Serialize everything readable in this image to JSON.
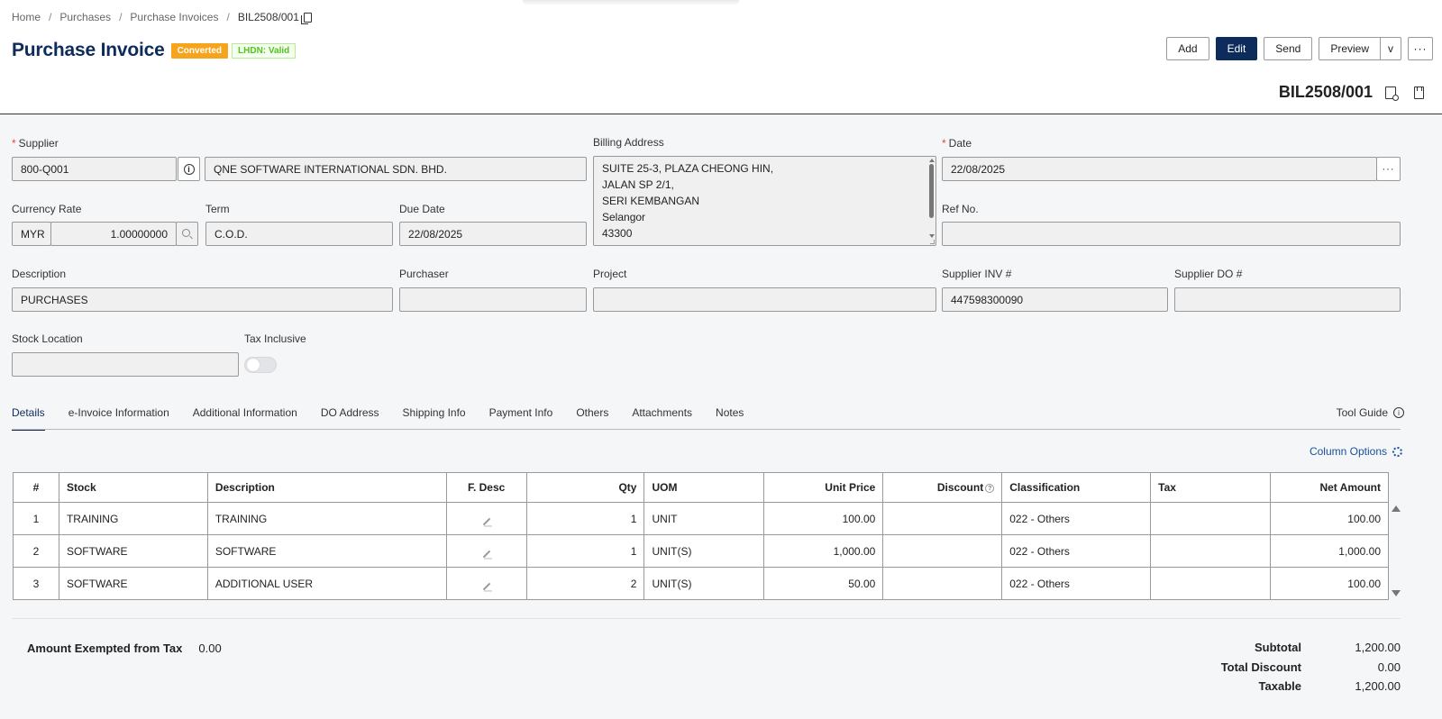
{
  "breadcrumb": [
    "Home",
    "Purchases",
    "Purchase Invoices",
    "BIL2508/001"
  ],
  "page_title": "Purchase Invoice",
  "badges": {
    "status": "Converted",
    "lhdn": "LHDN: Valid"
  },
  "actions": {
    "add": "Add",
    "edit": "Edit",
    "send": "Send",
    "preview": "Preview",
    "caret": "v",
    "more": "···"
  },
  "doc_number": "BIL2508/001",
  "form": {
    "supplier_label": "Supplier",
    "supplier_code": "800-Q001",
    "supplier_name": "QNE SOFTWARE INTERNATIONAL SDN. BHD.",
    "billing_label": "Billing Address",
    "billing_lines": [
      "SUITE 25-3, PLAZA CHEONG HIN,",
      "JALAN SP 2/1,",
      "SERI KEMBANGAN",
      "Selangor",
      "43300"
    ],
    "date_label": "Date",
    "date_value": "22/08/2025",
    "currency_label": "Currency Rate",
    "currency_code": "MYR",
    "currency_rate": "1.00000000",
    "term_label": "Term",
    "term_value": "C.O.D.",
    "due_label": "Due Date",
    "due_value": "22/08/2025",
    "ref_label": "Ref No.",
    "ref_value": "",
    "description_label": "Description",
    "description_value": "PURCHASES",
    "purchaser_label": "Purchaser",
    "purchaser_value": "",
    "project_label": "Project",
    "project_value": "",
    "supplier_inv_label": "Supplier INV #",
    "supplier_inv_value": "447598300090",
    "supplier_do_label": "Supplier DO #",
    "supplier_do_value": "",
    "stock_location_label": "Stock Location",
    "stock_location_value": "",
    "tax_inclusive_label": "Tax Inclusive",
    "tax_inclusive_on": false
  },
  "tabs": [
    "Details",
    "e-Invoice Information",
    "Additional Information",
    "DO Address",
    "Shipping Info",
    "Payment Info",
    "Others",
    "Attachments",
    "Notes"
  ],
  "tool_guide": "Tool Guide",
  "column_options": "Column Options",
  "table": {
    "headers": [
      "#",
      "Stock",
      "Description",
      "F. Desc",
      "Qty",
      "UOM",
      "Unit Price",
      "Discount",
      "Classification",
      "Tax",
      "Net Amount"
    ],
    "rows": [
      [
        "1",
        "TRAINING",
        "TRAINING",
        "",
        "1",
        "UNIT",
        "100.00",
        "",
        "022 - Others",
        "",
        "100.00"
      ],
      [
        "2",
        "SOFTWARE",
        "SOFTWARE",
        "",
        "1",
        "UNIT(S)",
        "1,000.00",
        "",
        "022 - Others",
        "",
        "1,000.00"
      ],
      [
        "3",
        "SOFTWARE",
        "ADDITIONAL USER",
        "",
        "2",
        "UNIT(S)",
        "50.00",
        "",
        "022 - Others",
        "",
        "100.00"
      ]
    ]
  },
  "summary": {
    "exempt_label": "Amount Exempted from Tax",
    "exempt_value": "0.00",
    "subtotal_label": "Subtotal",
    "subtotal_value": "1,200.00",
    "discount_label": "Total Discount",
    "discount_value": "0.00",
    "taxable_label": "Taxable",
    "taxable_value": "1,200.00"
  },
  "colors": {
    "primary": "#0d2c5c",
    "converted": "#f7a41d",
    "lhdn": "#52c41a",
    "link": "#1a4f9c",
    "required": "#e8423f"
  },
  "icons": [
    "copy-icon",
    "doc-search-icon",
    "bookmark-icon",
    "info-icon",
    "search-icon",
    "pencil-icon",
    "gear-icon",
    "help-icon"
  ]
}
